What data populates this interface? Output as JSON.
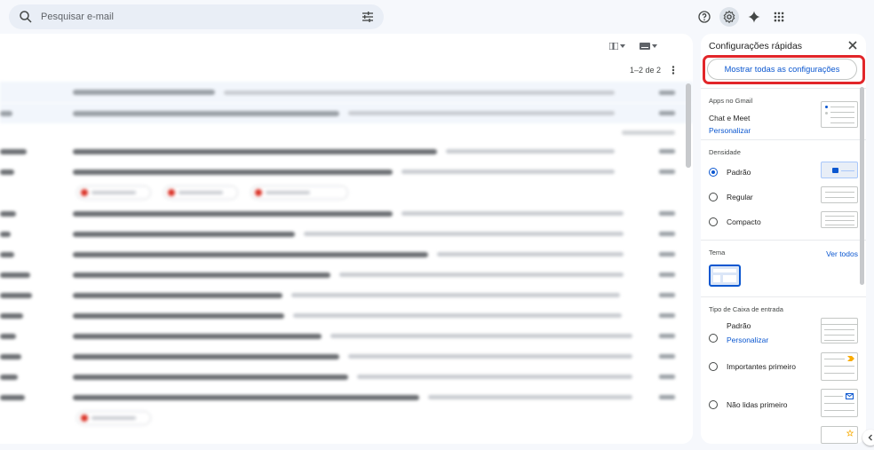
{
  "search": {
    "placeholder": "Pesquisar e-mail"
  },
  "pager": {
    "range": "1–2 de 2"
  },
  "quick_settings": {
    "title": "Configurações rápidas",
    "show_all": "Mostrar todas as configurações",
    "apps": {
      "title": "Apps no Gmail",
      "chat_meet": "Chat e Meet",
      "customize": "Personalizar"
    },
    "density": {
      "title": "Densidade",
      "options": [
        "Padrão",
        "Regular",
        "Compacto"
      ],
      "selected": "Padrão"
    },
    "theme": {
      "title": "Tema",
      "view_all": "Ver todos"
    },
    "inbox_type": {
      "title": "Tipo de Caixa de entrada",
      "default": "Padrão",
      "customize": "Personalizar",
      "important_first": "Importantes primeiro",
      "unread_first": "Não lidas primeiro"
    }
  },
  "colors": {
    "accent": "#0b57d0",
    "highlight": "#e2262a",
    "background": "#f6f8fc"
  },
  "icons": [
    "search-icon",
    "tune-icon",
    "help-icon",
    "settings-icon",
    "gemini-icon",
    "apps-grid-icon",
    "close-icon",
    "more-vert-icon",
    "chevron-left-icon"
  ]
}
